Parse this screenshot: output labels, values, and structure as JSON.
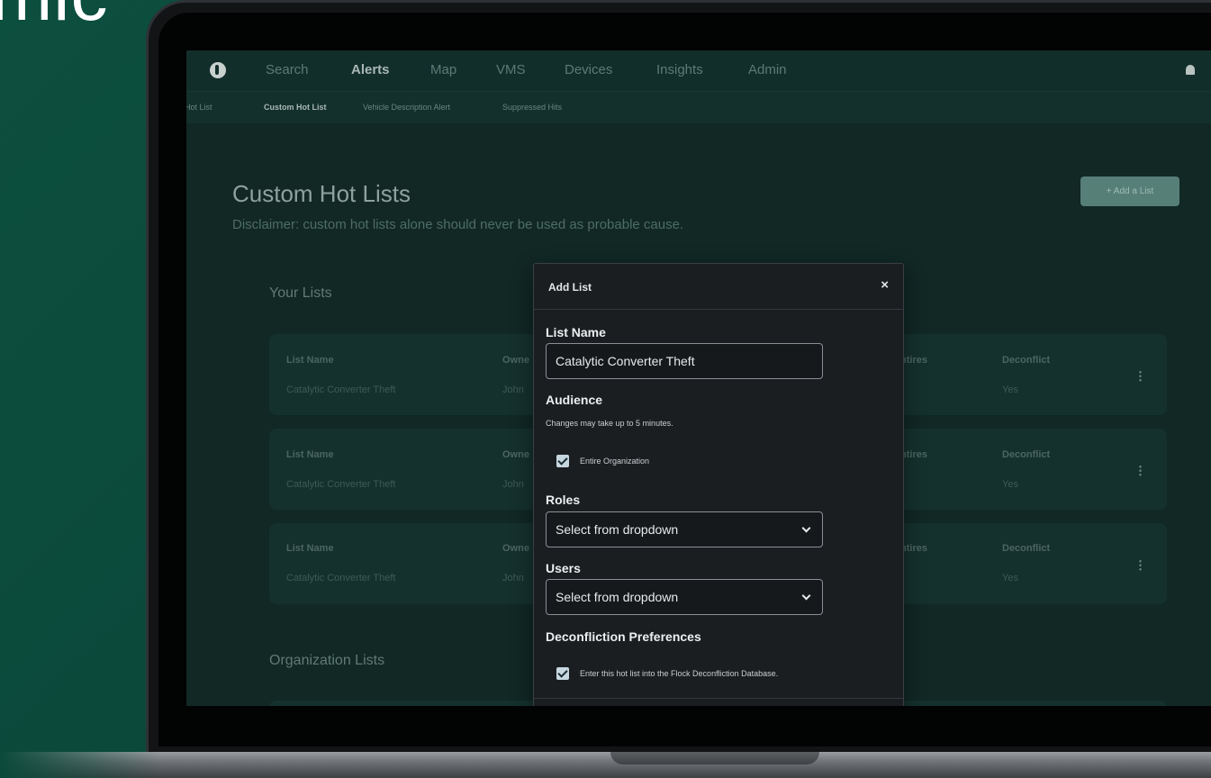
{
  "background": {
    "partial_text": "mic",
    "color": "#0d4f3f"
  },
  "topnav": {
    "items": [
      {
        "label": "Search",
        "active": false
      },
      {
        "label": "Alerts",
        "active": true
      },
      {
        "label": "Map",
        "active": false
      },
      {
        "label": "VMS",
        "active": false
      },
      {
        "label": "Devices",
        "active": false
      },
      {
        "label": "Insights",
        "active": false
      },
      {
        "label": "Admin",
        "active": false
      }
    ]
  },
  "subnav": {
    "items": [
      {
        "label": "Hot List",
        "active": false
      },
      {
        "label": "Custom Hot List",
        "active": true
      },
      {
        "label": "Vehicle Description Alert",
        "active": false
      },
      {
        "label": "Suppressed Hits",
        "active": false
      }
    ]
  },
  "page": {
    "title": "Custom Hot Lists",
    "disclaimer": "Disclaimer: custom hot lists alone should never be used as probable cause.",
    "add_button": "+ Add a List",
    "your_lists_title": "Your Lists",
    "org_lists_title": "Organization Lists"
  },
  "lists": [
    {
      "name_label": "List Name",
      "name": "Catalytic Converter Theft",
      "owner_label": "Owne",
      "owner": "John",
      "expires_label": "ntires",
      "deconflict_label": "Deconflict",
      "deconflict": "Yes"
    },
    {
      "name_label": "List Name",
      "name": "Catalytic Converter Theft",
      "owner_label": "Owne",
      "owner": "John",
      "expires_label": "ntires",
      "deconflict_label": "Deconflict",
      "deconflict": "Yes"
    },
    {
      "name_label": "List Name",
      "name": "Catalytic Converter Theft",
      "owner_label": "Owne",
      "owner": "John",
      "expires_label": "ntires",
      "deconflict_label": "Deconflict",
      "deconflict": "Yes"
    }
  ],
  "modal": {
    "title": "Add List",
    "close": "×",
    "list_name_label": "List Name",
    "list_name_value": "Catalytic Converter Theft",
    "audience_label": "Audience",
    "audience_note": "Changes may take up to 5 minutes.",
    "entire_org_label": "Entire Organization",
    "entire_org_checked": true,
    "roles_label": "Roles",
    "roles_placeholder": "Select from dropdown",
    "users_label": "Users",
    "users_placeholder": "Select from dropdown",
    "deconfliction_label": "Deconfliction Preferences",
    "deconfliction_check_label": "Enter this hot list into the Flock Deconfliction Database.",
    "deconfliction_checked": true
  }
}
